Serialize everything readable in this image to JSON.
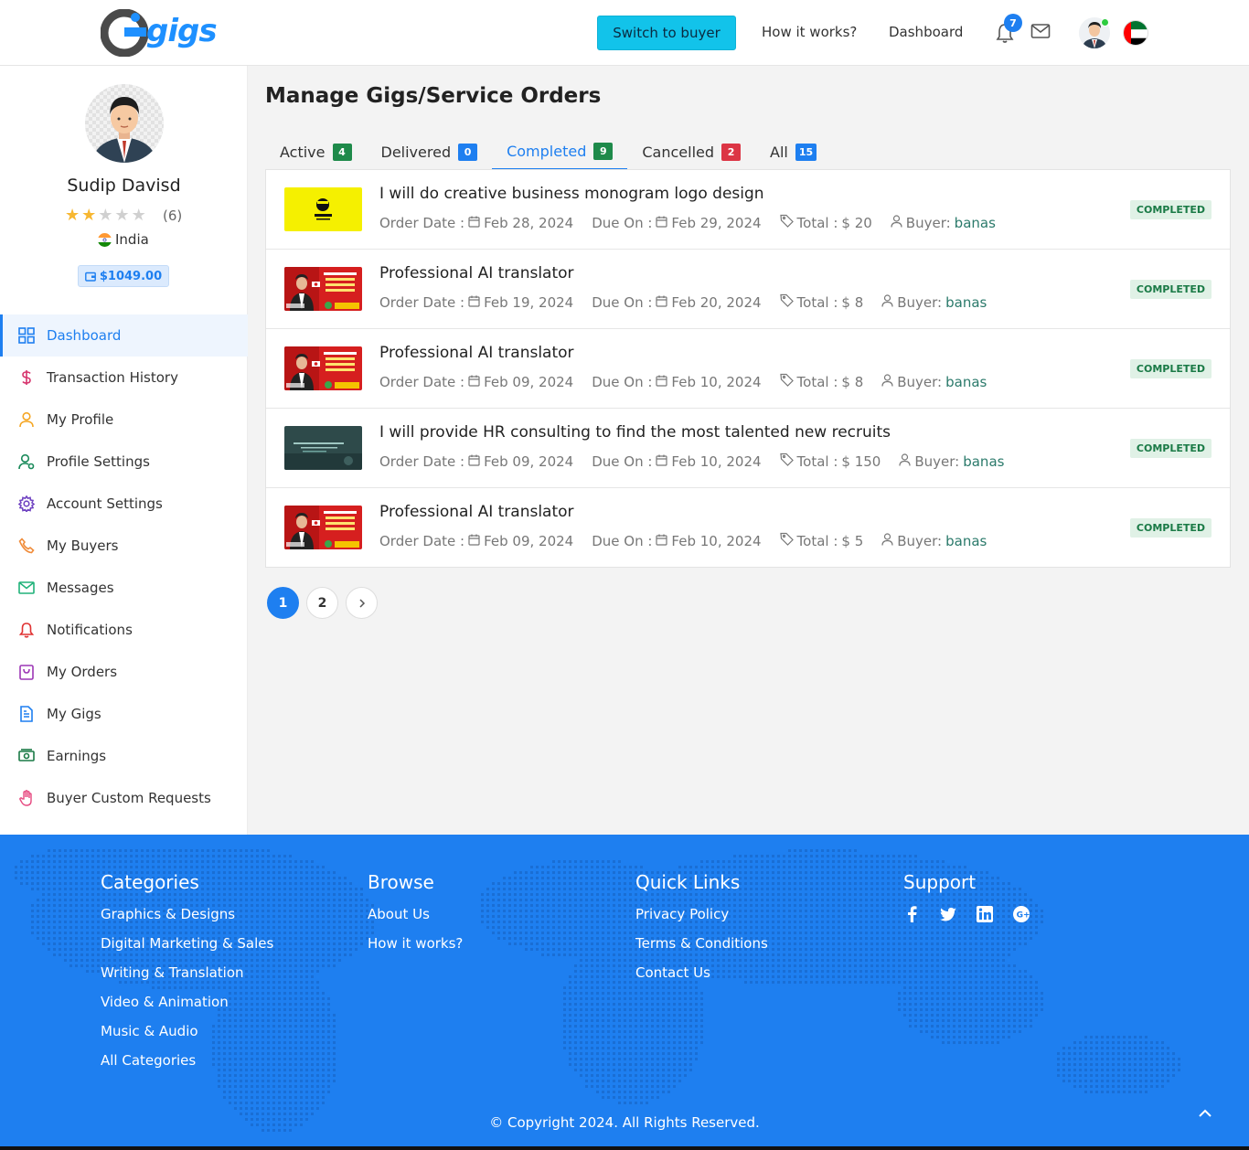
{
  "header": {
    "logo_text": "gigs",
    "switch_label": "Switch to buyer",
    "how_it_works": "How it works?",
    "dashboard": "Dashboard",
    "notification_count": "7"
  },
  "profile": {
    "name": "Sudip Davisd",
    "rating_stars": 2,
    "rating_max": 5,
    "rating_count": "(6)",
    "country": "India",
    "balance": "$1049.00"
  },
  "sidebar": {
    "items": [
      {
        "label": "Dashboard",
        "icon": "grid-icon",
        "active": true
      },
      {
        "label": "Transaction History",
        "icon": "dollar-icon"
      },
      {
        "label": "My Profile",
        "icon": "user-icon"
      },
      {
        "label": "Profile Settings",
        "icon": "user-settings-icon"
      },
      {
        "label": "Account Settings",
        "icon": "gear-icon"
      },
      {
        "label": "My Buyers",
        "icon": "phone-icon"
      },
      {
        "label": "Messages",
        "icon": "mail-icon"
      },
      {
        "label": "Notifications",
        "icon": "bell-icon"
      },
      {
        "label": "My Orders",
        "icon": "bag-icon"
      },
      {
        "label": "My Gigs",
        "icon": "file-icon"
      },
      {
        "label": "Earnings",
        "icon": "cash-icon"
      },
      {
        "label": "Buyer Custom Requests",
        "icon": "hand-icon"
      }
    ]
  },
  "main": {
    "title": "Manage Gigs/Service Orders",
    "tabs": [
      {
        "label": "Active",
        "count": "4",
        "color": "#1e8a4a"
      },
      {
        "label": "Delivered",
        "count": "0",
        "color": "#1e7ff0"
      },
      {
        "label": "Completed",
        "count": "9",
        "color": "#1e8a4a",
        "active": true
      },
      {
        "label": "Cancelled",
        "count": "2",
        "color": "#dc3545"
      },
      {
        "label": "All",
        "count": "15",
        "color": "#1e7ff0"
      }
    ],
    "order_date_label": "Order Date :",
    "due_label": "Due On :",
    "total_label": "Total :",
    "buyer_label": "Buyer:",
    "orders": [
      {
        "title": "I will do creative business monogram logo design",
        "order_date": "Feb 28, 2024",
        "due_date": "Feb 29, 2024",
        "total": "$ 20",
        "buyer": "banas",
        "status": "COMPLETED",
        "thumb": "logo"
      },
      {
        "title": "Professional AI translator",
        "order_date": "Feb 19, 2024",
        "due_date": "Feb 20, 2024",
        "total": "$ 8",
        "buyer": "banas",
        "status": "COMPLETED",
        "thumb": "translator"
      },
      {
        "title": "Professional AI translator",
        "order_date": "Feb 09, 2024",
        "due_date": "Feb 10, 2024",
        "total": "$ 8",
        "buyer": "banas",
        "status": "COMPLETED",
        "thumb": "translator"
      },
      {
        "title": "I will provide HR consulting to find the most talented new recruits",
        "order_date": "Feb 09, 2024",
        "due_date": "Feb 10, 2024",
        "total": "$ 150",
        "buyer": "banas",
        "status": "COMPLETED",
        "thumb": "hr"
      },
      {
        "title": "Professional AI translator",
        "order_date": "Feb 09, 2024",
        "due_date": "Feb 10, 2024",
        "total": "$ 5",
        "buyer": "banas",
        "status": "COMPLETED",
        "thumb": "translator"
      }
    ],
    "pages": [
      "1",
      "2"
    ],
    "current_page": "1"
  },
  "footer": {
    "categories": {
      "heading": "Categories",
      "links": [
        "Graphics & Designs",
        "Digital Marketing & Sales",
        "Writing & Translation",
        "Video & Animation",
        "Music & Audio",
        "All Categories"
      ]
    },
    "browse": {
      "heading": "Browse",
      "links": [
        "About Us",
        "How it works?"
      ]
    },
    "quick_links": {
      "heading": "Quick Links",
      "links": [
        "Privacy Policy",
        "Terms & Conditions",
        "Contact Us"
      ]
    },
    "support": {
      "heading": "Support",
      "social": [
        "facebook-icon",
        "twitter-icon",
        "linkedin-icon",
        "google-plus-icon"
      ]
    },
    "copyright": "© Copyright 2024. All Rights Reserved."
  },
  "colors": {
    "accent": "#1e7ff0",
    "switch_button": "#12c3ea",
    "completed_badge": "#e0f1e6"
  }
}
